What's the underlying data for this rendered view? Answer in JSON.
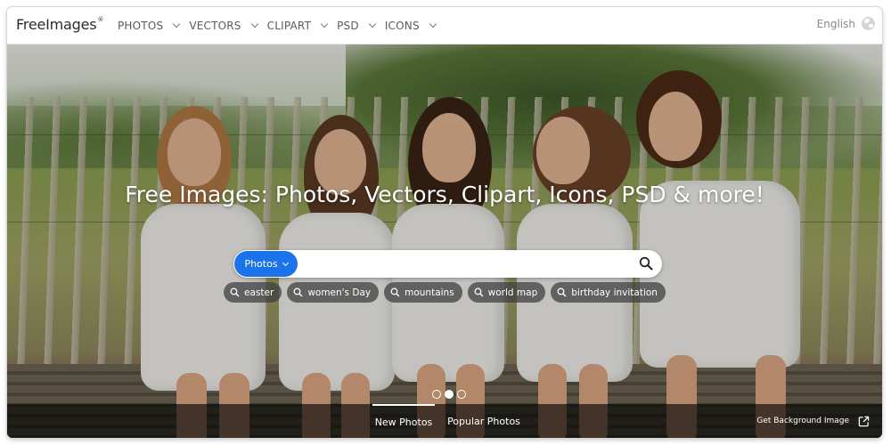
{
  "header": {
    "logo": "FreeImages",
    "logo_mark": "®",
    "nav": [
      {
        "label": "PHOTOS"
      },
      {
        "label": "VECTORS"
      },
      {
        "label": "CLIPART"
      },
      {
        "label": "PSD"
      },
      {
        "label": "ICONS"
      }
    ],
    "language": "English",
    "language_icon": "globe-icon"
  },
  "hero": {
    "title": "Free Images: Photos, Vectors, Clipart, Icons, PSD & more!",
    "search": {
      "type_label": "Photos",
      "placeholder": "",
      "search_icon": "search-icon"
    },
    "tags": [
      {
        "label": "easter"
      },
      {
        "label": "women's Day"
      },
      {
        "label": "mountains"
      },
      {
        "label": "world map"
      },
      {
        "label": "birthday invitation"
      }
    ],
    "carousel": {
      "count": 3,
      "active_index": 1
    }
  },
  "bottom_bar": {
    "tabs": [
      {
        "label": "New Photos",
        "active": true
      },
      {
        "label": "Popular Photos",
        "active": false
      }
    ],
    "get_background": "Get Background Image",
    "external_icon": "external-link-icon"
  },
  "colors": {
    "accent": "#1a73e8",
    "tag_bg": "#3c3c3c",
    "bottom_bar_bg": "#000000"
  }
}
